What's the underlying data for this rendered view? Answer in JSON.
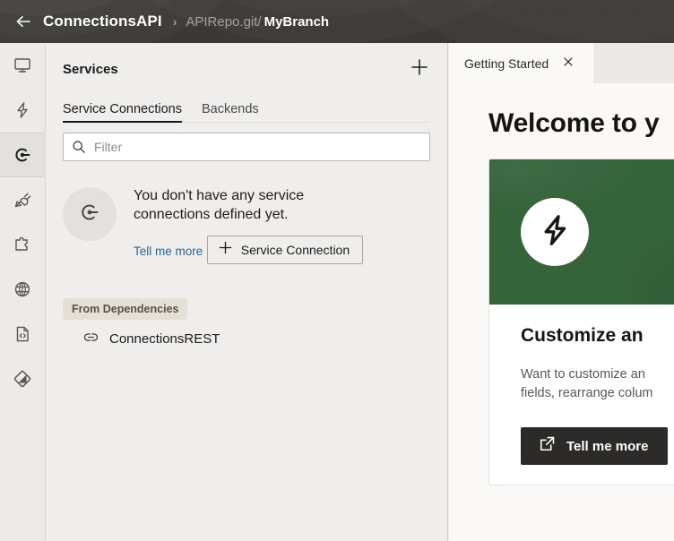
{
  "header": {
    "back_icon": "arrow-left-icon",
    "project": "ConnectionsAPI",
    "separator": "›",
    "repo": "APIRepo.git/",
    "branch": "MyBranch"
  },
  "rail": {
    "items": [
      {
        "name": "monitor-icon",
        "label": "Overview",
        "active": false
      },
      {
        "name": "lightning-icon",
        "label": "Quick Actions",
        "active": false
      },
      {
        "name": "connections-icon",
        "label": "Services",
        "active": true
      },
      {
        "name": "plug-icon",
        "label": "Connectors",
        "active": false
      },
      {
        "name": "puzzle-icon",
        "label": "Extensions",
        "active": false
      },
      {
        "name": "globe-icon",
        "label": "Web",
        "active": false
      },
      {
        "name": "code-file-icon",
        "label": "Source",
        "active": false
      },
      {
        "name": "git-icon",
        "label": "Version Control",
        "active": false
      }
    ]
  },
  "services": {
    "title": "Services",
    "add_icon": "plus-icon",
    "tabs": [
      {
        "label": "Service Connections",
        "active": true
      },
      {
        "label": "Backends",
        "active": false
      }
    ],
    "filter": {
      "icon": "search-icon",
      "placeholder": "Filter",
      "value": ""
    },
    "empty_state": {
      "icon": "connections-icon",
      "message": "You don't have any service connections defined yet.",
      "link": "Tell me more",
      "button": {
        "icon": "plus-icon",
        "label": "Service Connection"
      }
    },
    "dependencies": {
      "badge": "From Dependencies",
      "items": [
        {
          "icon": "link-icon",
          "label": "ConnectionsREST"
        }
      ]
    }
  },
  "editor": {
    "tabs": [
      {
        "label": "Getting Started",
        "close_icon": "close-icon",
        "active": true
      }
    ],
    "welcome_title": "Welcome to y",
    "card": {
      "hero_icon": "lightning-icon",
      "hero_color": "#35633a",
      "title": "Customize an",
      "description_line1": "Want to customize an",
      "description_line2": "fields, rearrange colum",
      "button": {
        "icon": "external-link-icon",
        "label": "Tell me more"
      }
    }
  },
  "colors": {
    "header_bg": "#3b3835",
    "panel_bg": "#efeeec",
    "editor_bg": "#faf9f7",
    "accent_link": "#2a6496",
    "card_green": "#35633a",
    "button_dark": "#2d2b29",
    "badge_bg": "#e5e0d7"
  }
}
